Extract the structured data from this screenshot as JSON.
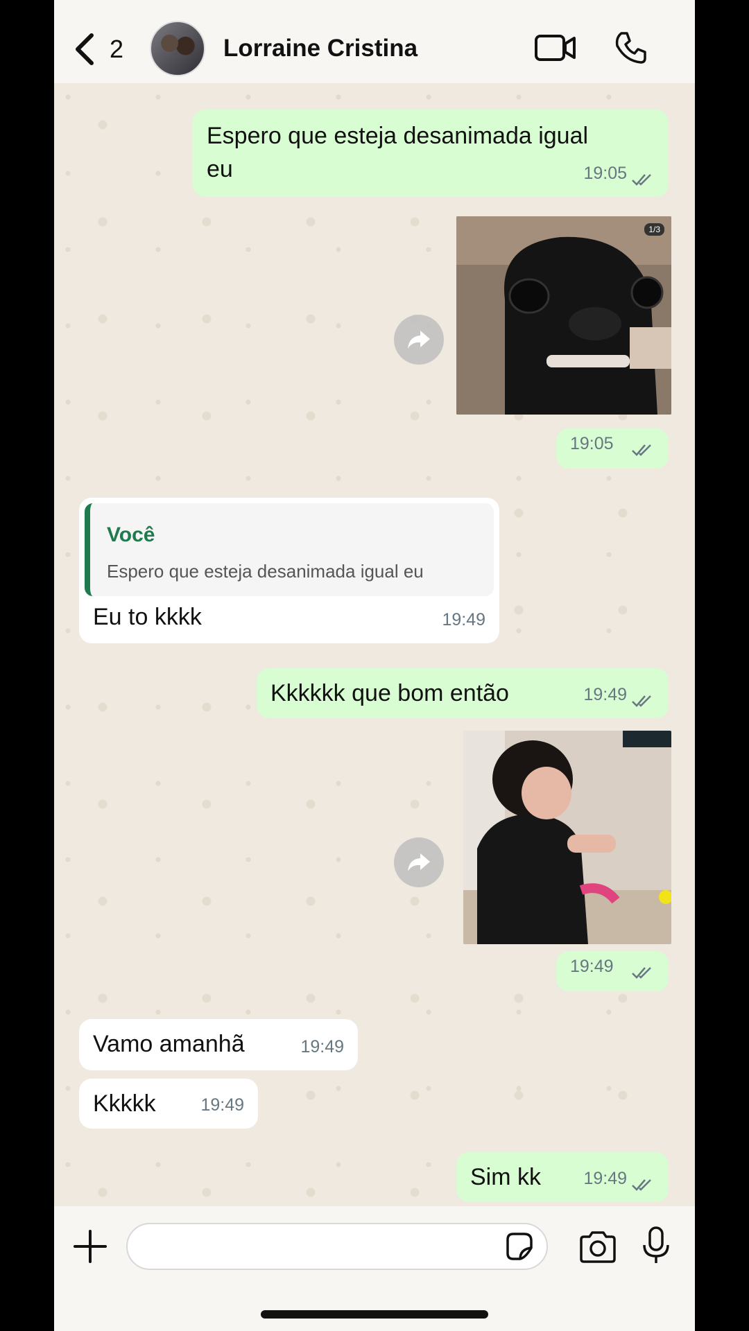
{
  "header": {
    "back_count": "2",
    "contact_name": "Lorraine Cristina"
  },
  "messages": [
    {
      "text": "Espero que esteja desanimada igual eu",
      "time": "19:05",
      "direction": "outgoing"
    },
    {
      "media": "sticker-dog",
      "time": "19:05",
      "direction": "outgoing",
      "badge": "1/3"
    },
    {
      "quote_author": "Você",
      "quote_text": "Espero que esteja desanimada igual eu",
      "text": "Eu to kkkk",
      "time": "19:49",
      "direction": "incoming"
    },
    {
      "text": "Kkkkkk que bom então",
      "time": "19:49",
      "direction": "outgoing"
    },
    {
      "media": "sticker-child",
      "time": "19:49",
      "direction": "outgoing"
    },
    {
      "text": "Vamo amanhã",
      "time": "19:49",
      "direction": "incoming"
    },
    {
      "text": "Kkkkk",
      "time": "19:49",
      "direction": "incoming"
    },
    {
      "text": "Sim kk",
      "time": "19:49",
      "direction": "outgoing"
    }
  ],
  "colors": {
    "outgoing_bubble": "#d9fdd3",
    "incoming_bubble": "#ffffff",
    "accent": "#1f7a4d",
    "read_ticks": "#667781"
  }
}
